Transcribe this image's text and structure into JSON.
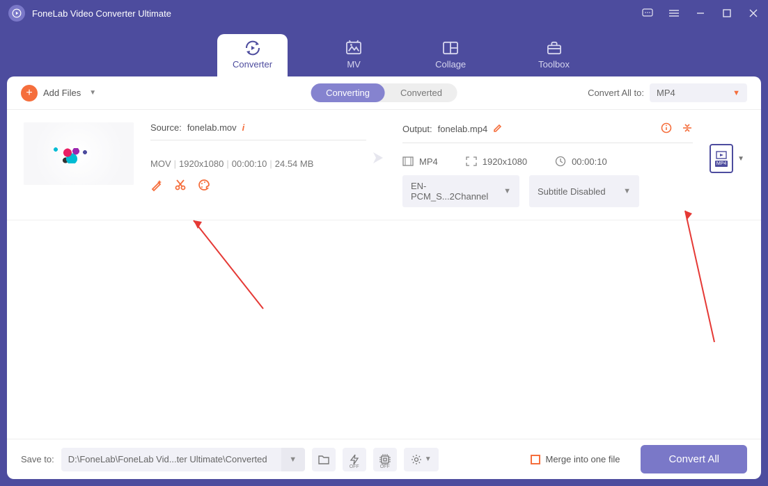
{
  "window": {
    "title": "FoneLab Video Converter Ultimate"
  },
  "nav": {
    "tabs": [
      {
        "label": "Converter",
        "active": true
      },
      {
        "label": "MV",
        "active": false
      },
      {
        "label": "Collage",
        "active": false
      },
      {
        "label": "Toolbox",
        "active": false
      }
    ]
  },
  "toolbar": {
    "add_files": "Add Files",
    "modes": {
      "converting": "Converting",
      "converted": "Converted"
    },
    "convert_all_to_label": "Convert All to:",
    "convert_all_to_value": "MP4"
  },
  "file": {
    "source": {
      "label": "Source:",
      "name": "fonelab.mov",
      "container": "MOV",
      "resolution": "1920x1080",
      "duration": "00:00:10",
      "size": "24.54 MB"
    },
    "output": {
      "label": "Output:",
      "name": "fonelab.mp4",
      "container": "MP4",
      "resolution": "1920x1080",
      "duration": "00:00:10",
      "audio_select": "EN-PCM_S...2Channel",
      "subtitle_select": "Subtitle Disabled",
      "format_tile": "MP4"
    }
  },
  "footer": {
    "save_to_label": "Save to:",
    "save_path": "D:\\FoneLab\\FoneLab Vid...ter Ultimate\\Converted",
    "merge_label": "Merge into one file",
    "convert_btn": "Convert All",
    "off": "OFF"
  },
  "colors": {
    "primary": "#4d4c9e",
    "accent": "#f56e3c"
  }
}
